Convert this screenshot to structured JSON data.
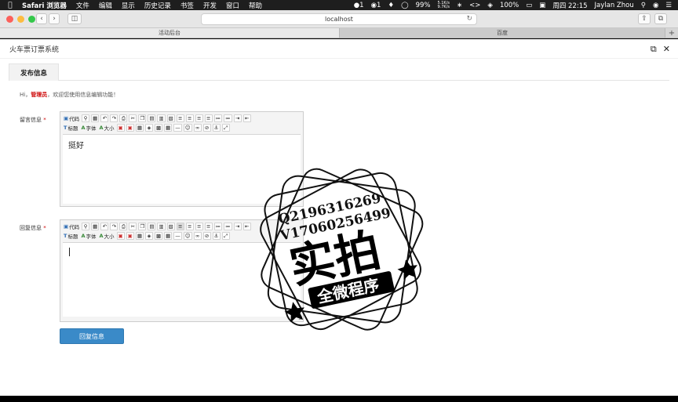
{
  "menubar": {
    "app": "Safari 浏览器",
    "items": [
      "文件",
      "编辑",
      "显示",
      "历史记录",
      "书签",
      "开发",
      "窗口",
      "帮助"
    ],
    "status": {
      "badge1": "1",
      "badge2": "1",
      "battery_circle": "",
      "battery": "99%",
      "net_up": "5.1K/s",
      "net_down": "9.7K/s",
      "battery2": "100%",
      "clock": "周四 22:15",
      "user": "Jaylan Zhou"
    }
  },
  "browser": {
    "url": "localhost",
    "tabs": [
      "活动后台",
      "百度"
    ],
    "new_tab": "+"
  },
  "page": {
    "title": "火车票订票系统",
    "tab_label": "发布信息",
    "welcome_prefix": "Hi，",
    "welcome_user": "管理员",
    "welcome_suffix": "，欢迎您使用信息编辑功能！",
    "fields": {
      "message_label": "留言信息",
      "reply_label": "回复信息",
      "required_mark": "*"
    },
    "toolbar": {
      "code": "代码",
      "heading": "标题",
      "font": "字体",
      "size": "大小"
    },
    "message_content": "挺好",
    "reply_content": "",
    "submit": "回复信息"
  },
  "watermark": {
    "line1": "Q2196316269",
    "line2": "V17060256499",
    "big": "实拍",
    "ribbon": "全微程序"
  },
  "colors": {
    "accent": "#3a8ac8",
    "required": "#cc0000",
    "menubar": "#1e1e1e"
  }
}
